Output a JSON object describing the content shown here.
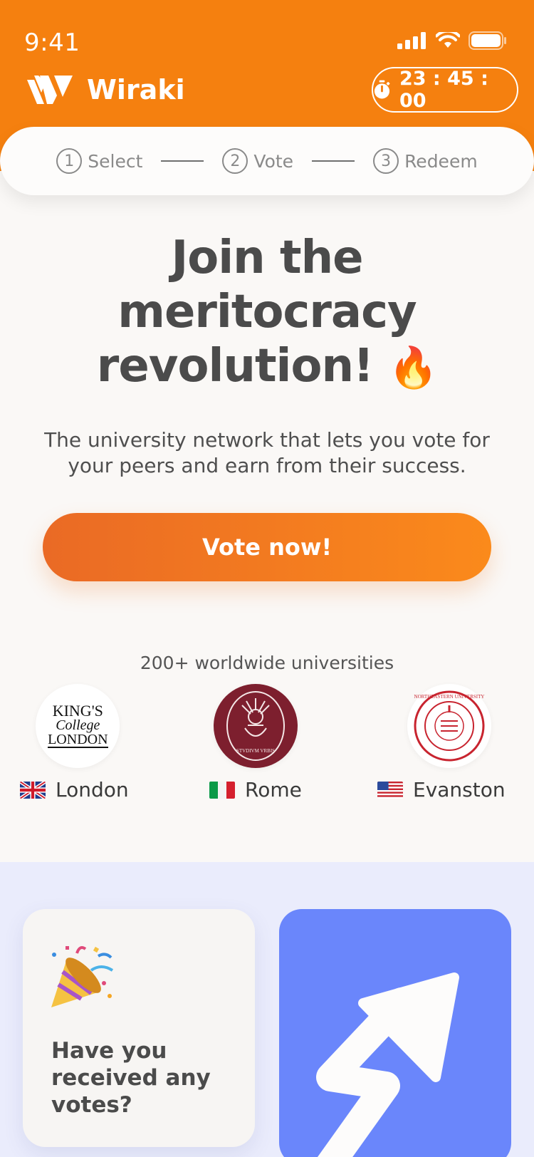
{
  "status_bar": {
    "time": "9:41"
  },
  "header": {
    "app_name": "Wiraki",
    "timer": "23 : 45 : 00"
  },
  "steps": [
    {
      "number": "1",
      "label": "Select"
    },
    {
      "number": "2",
      "label": "Vote"
    },
    {
      "number": "3",
      "label": "Redeem"
    }
  ],
  "hero": {
    "title_line1": "Join the",
    "title_line2": "meritocracy",
    "title_line3": "revolution!",
    "title_emoji": "🔥",
    "subtitle": "The university network that lets you vote for your peers and earn from their success.",
    "cta": "Vote now!"
  },
  "universities": {
    "caption": "200+ worldwide universities",
    "items": [
      {
        "city": "London",
        "logo_line1": "KING'S",
        "logo_line2": "College",
        "logo_line3": "LONDON"
      },
      {
        "city": "Rome",
        "logo_text": "STVDIVM VRBIS"
      },
      {
        "city": "Evanston",
        "logo_text": "NORTHEASTERN UNIVERSITY"
      }
    ]
  },
  "cards": {
    "votes_title": "Have you received any votes?",
    "votes_icon": "party-popper-icon"
  }
}
